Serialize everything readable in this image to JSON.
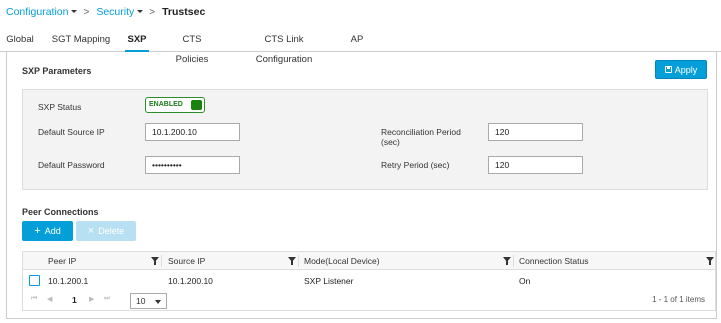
{
  "breadcrumb": {
    "items": [
      "Configuration",
      "Security"
    ],
    "current": "Trustsec"
  },
  "tabs": [
    "Global",
    "SGT Mapping",
    "SXP",
    "CTS Policies",
    "CTS Link Configuration",
    "AP"
  ],
  "active_tab": "SXP",
  "sxp_parameters": {
    "title": "SXP Parameters",
    "apply_label": "Apply",
    "status_label": "SXP Status",
    "status_value": "ENABLED",
    "default_source_ip_label": "Default Source IP",
    "default_source_ip_value": "10.1.200.10",
    "default_password_label": "Default Password",
    "default_password_value": "••••••••••",
    "reconciliation_label_line1": "Reconciliation Period",
    "reconciliation_label_line2": "(sec)",
    "reconciliation_value": "120",
    "retry_label": "Retry Period (sec)",
    "retry_value": "120"
  },
  "peer_connections": {
    "title": "Peer Connections",
    "add_label": "Add",
    "delete_label": "Delete",
    "columns": [
      "Peer IP",
      "Source IP",
      "Mode(Local Device)",
      "Connection Status"
    ],
    "rows": [
      {
        "peer_ip": "10.1.200.1",
        "source_ip": "10.1.200.10",
        "mode": "SXP Listener",
        "status": "On"
      }
    ],
    "pager": {
      "first_icon": "⏮",
      "prev_icon": "◀",
      "current_page": "1",
      "next_icon": "▶",
      "last_icon": "⏭",
      "page_size": "10",
      "count_text": "1 - 1 of 1 items"
    }
  },
  "colors": {
    "accent": "#049fd9",
    "enabled_green": "#19820f"
  }
}
